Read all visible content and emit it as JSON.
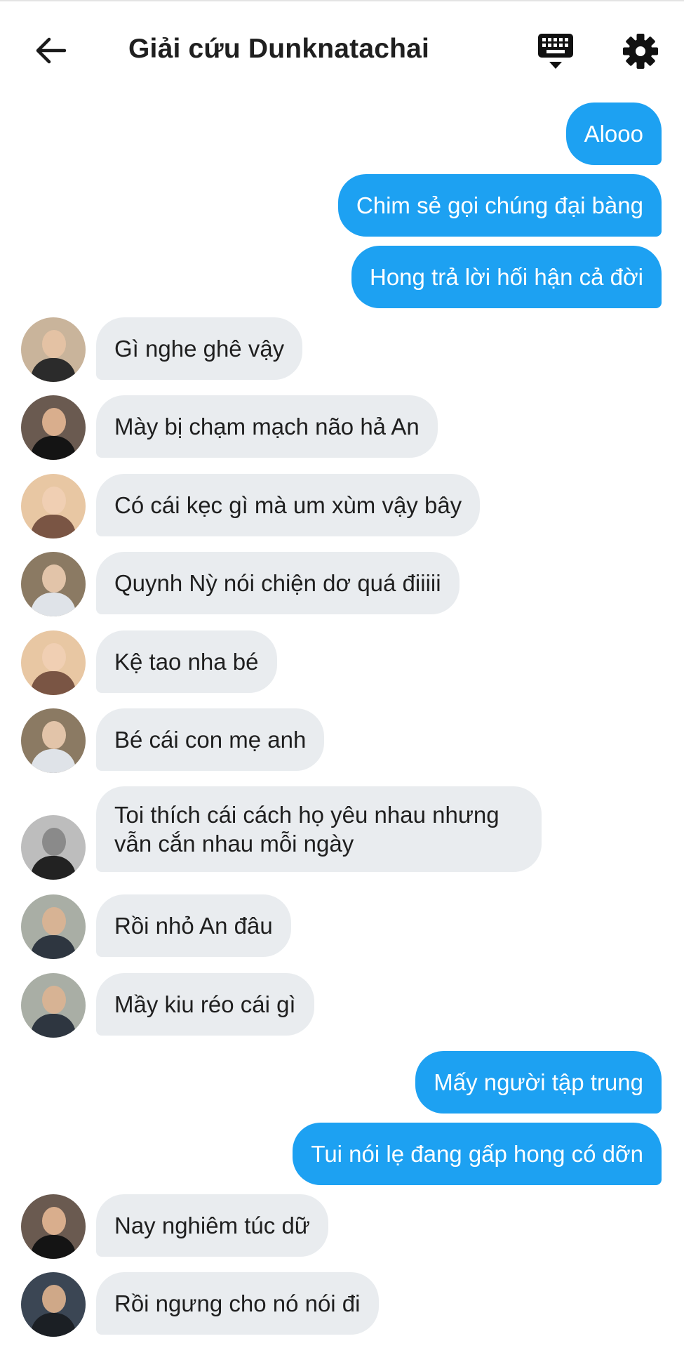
{
  "header": {
    "title": "Giải cứu Dunknatachai",
    "back_icon": "arrow-left-icon",
    "keyboard_icon": "keyboard-icon",
    "settings_icon": "gear-icon"
  },
  "colors": {
    "outgoing_bubble": "#1da1f2",
    "incoming_bubble": "#e9ecef",
    "text_dark": "#1f1f1f"
  },
  "messages": [
    {
      "dir": "out",
      "text": "Alooo"
    },
    {
      "dir": "out",
      "text": "Chim sẻ gọi chúng đại bàng"
    },
    {
      "dir": "out",
      "text": "Hong trả lời hối hận cả đời"
    },
    {
      "dir": "in",
      "text": "Gì nghe ghê vậy"
    },
    {
      "dir": "in",
      "text": "Mày bị chạm mạch não hả An"
    },
    {
      "dir": "in",
      "text": "Có cái kẹc gì mà um xùm vậy bây"
    },
    {
      "dir": "in",
      "text": "Quynh Nỳ nói chiện dơ quá điiiii"
    },
    {
      "dir": "in",
      "text": "Kệ tao nha bé"
    },
    {
      "dir": "in",
      "text": "Bé cái con mẹ anh"
    },
    {
      "dir": "in",
      "text": "Toi thích cái cách họ yêu nhau nhưng vẫn cắn nhau mỗi ngày"
    },
    {
      "dir": "in",
      "text": "Rồi nhỏ An đâu"
    },
    {
      "dir": "in",
      "text": "Mầy kiu réo cái gì"
    },
    {
      "dir": "out",
      "text": "Mấy người tập trung"
    },
    {
      "dir": "out",
      "text": "Tui nói lẹ đang gấp hong có dỡn"
    },
    {
      "dir": "in",
      "text": "Nay nghiêm túc dữ"
    },
    {
      "dir": "in",
      "text": "Rồi ngưng cho nó nói đi"
    }
  ]
}
